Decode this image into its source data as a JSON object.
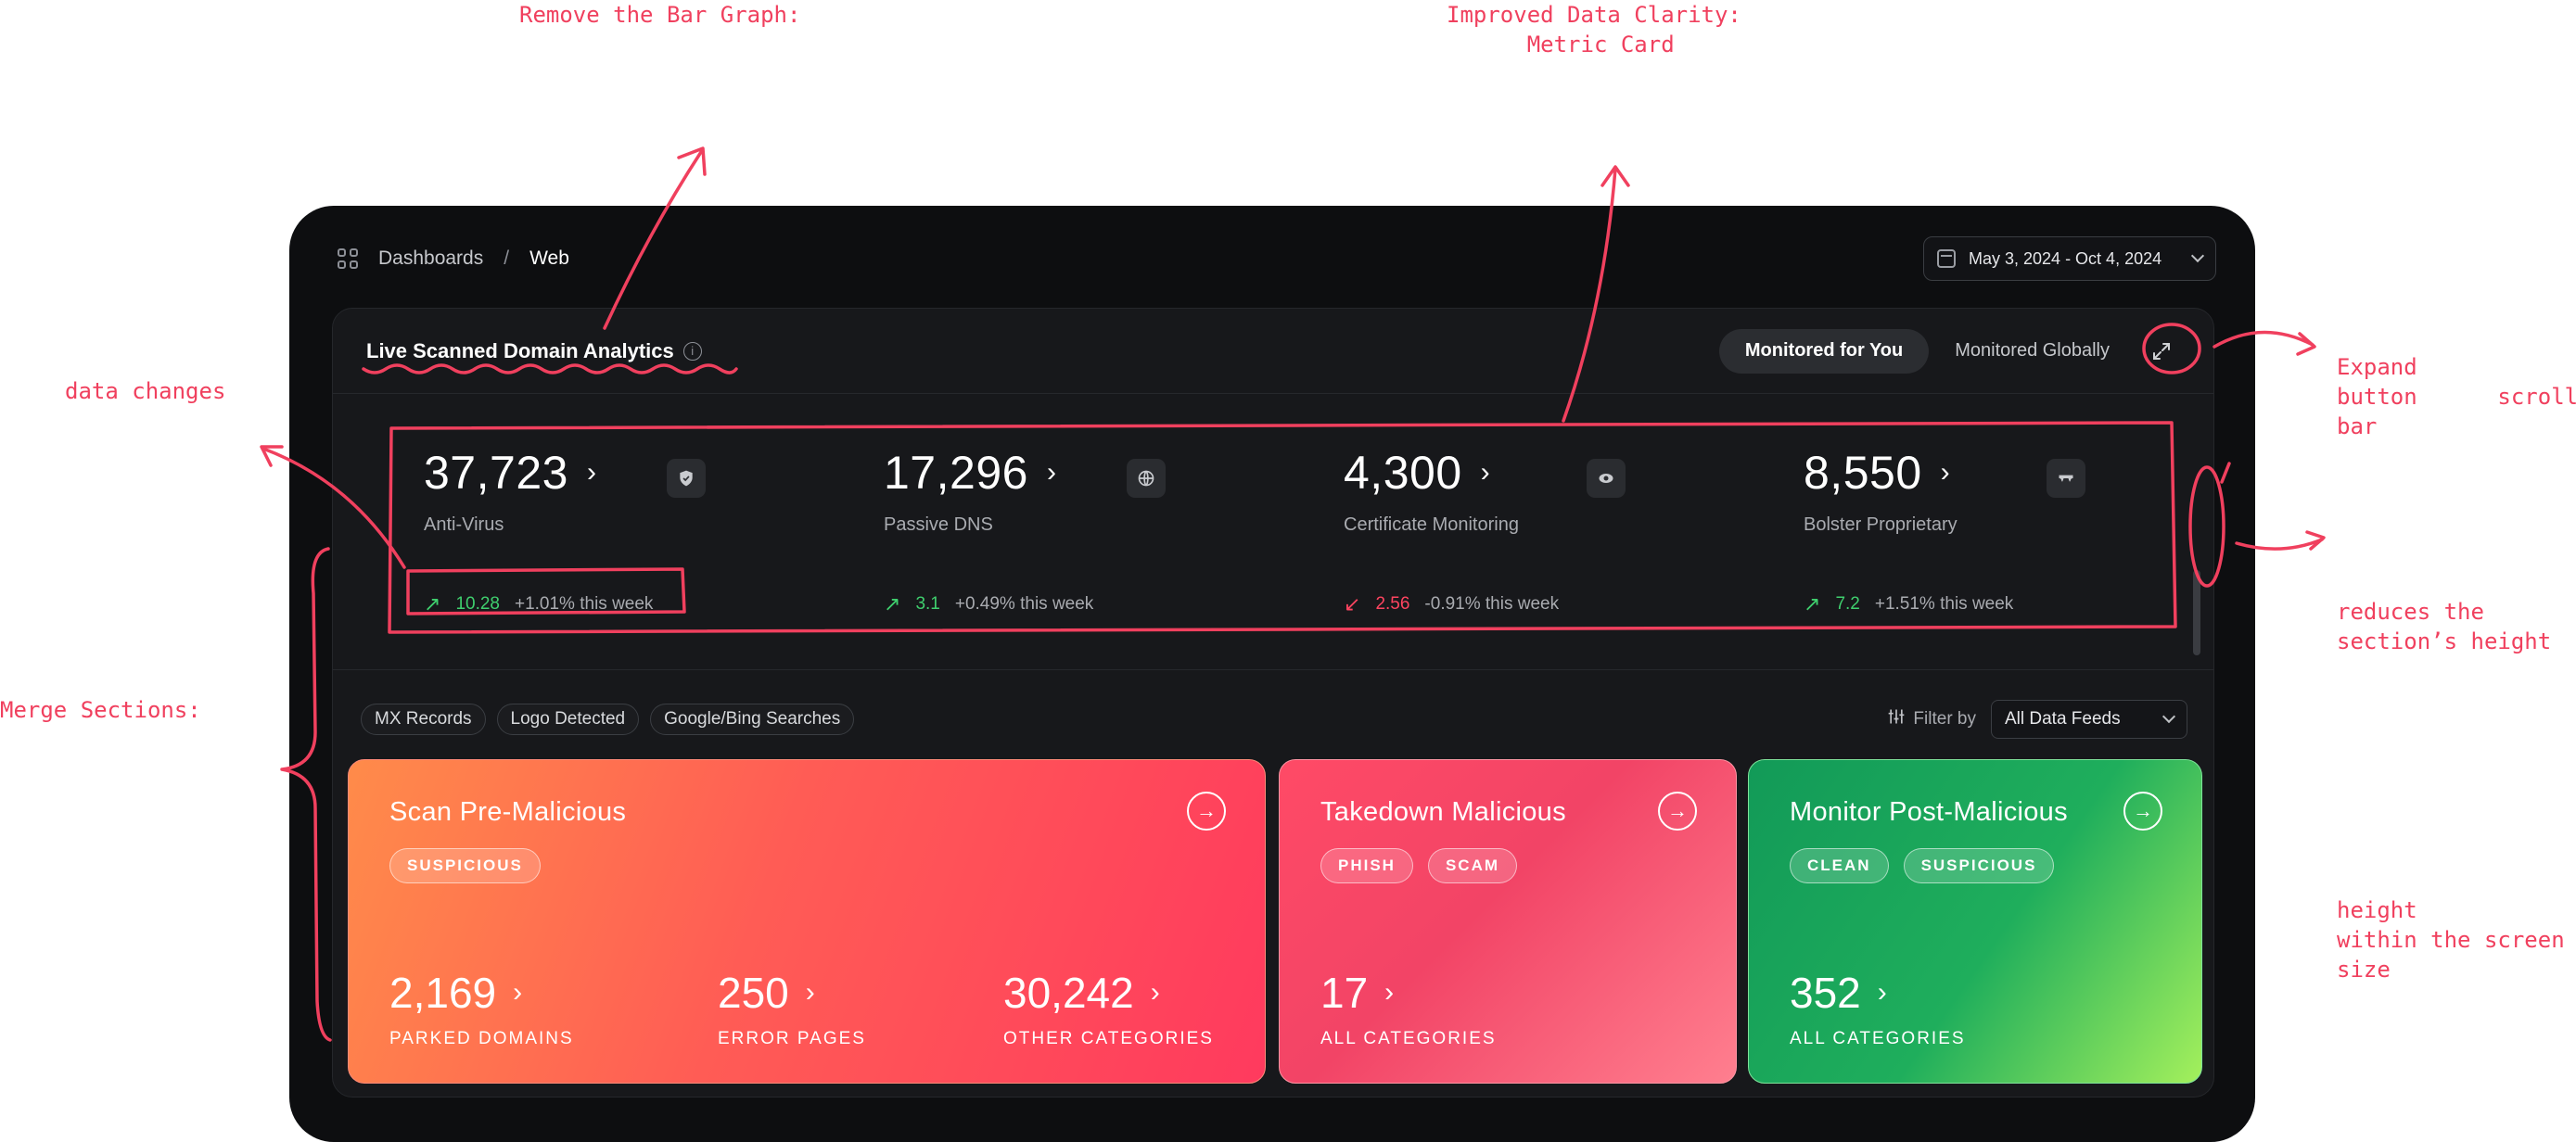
{
  "annotations": {
    "remove_bar": "Remove the Bar Graph:",
    "clarity": "Improved Data Clarity:\n      Metric Card",
    "data_changes": "data changes",
    "merge": "Merge Sections:",
    "expand": "Expand\nbutton      scroll\nbar",
    "reduces": "reduces the\nsection’s height",
    "height": "height\nwithin the screen\nsize"
  },
  "breadcrumb": {
    "root": "Dashboards",
    "separator": "/",
    "current": "Web"
  },
  "date_range": "May 3, 2024 - Oct 4, 2024",
  "panel": {
    "title": "Live Scanned Domain Analytics",
    "tabs": [
      "Monitored for You",
      "Monitored Globally"
    ]
  },
  "metrics": [
    {
      "value": "37,723",
      "label": "Anti-Virus",
      "trend": "up",
      "change": "10.28",
      "week": "+1.01% this week",
      "icon": "shield-icon"
    },
    {
      "value": "17,296",
      "label": "Passive DNS",
      "trend": "up",
      "change": "3.1",
      "week": "+0.49% this week",
      "icon": "globe-icon"
    },
    {
      "value": "4,300",
      "label": "Certificate Monitoring",
      "trend": "down",
      "change": "2.56",
      "week": "-0.91% this week",
      "icon": "eye-icon"
    },
    {
      "value": "8,550",
      "label": "Bolster Proprietary",
      "trend": "up",
      "change": "7.2",
      "week": "+1.51% this week",
      "icon": "mask-icon"
    }
  ],
  "filters": {
    "chips": [
      "MX Records",
      "Logo Detected",
      "Google/Bing Searches"
    ],
    "filter_label": "Filter by",
    "selected": "All Data Feeds"
  },
  "cards": {
    "pre": {
      "title": "Scan Pre-Malicious",
      "tags": [
        "SUSPICIOUS"
      ],
      "stats": [
        {
          "value": "2,169",
          "label": "PARKED DOMAINS"
        },
        {
          "value": "250",
          "label": "ERROR PAGES"
        },
        {
          "value": "30,242",
          "label": "OTHER CATEGORIES"
        }
      ]
    },
    "take": {
      "title": "Takedown Malicious",
      "tags": [
        "PHISH",
        "SCAM"
      ],
      "stats": [
        {
          "value": "17",
          "label": "ALL CATEGORIES"
        }
      ]
    },
    "post": {
      "title": "Monitor Post-Malicious",
      "tags": [
        "CLEAN",
        "SUSPICIOUS"
      ],
      "stats": [
        {
          "value": "352",
          "label": "ALL CATEGORIES"
        }
      ]
    }
  },
  "colors": {
    "annotation": "#f0405e",
    "up": "#3fcf6e",
    "down": "#ff4460"
  }
}
